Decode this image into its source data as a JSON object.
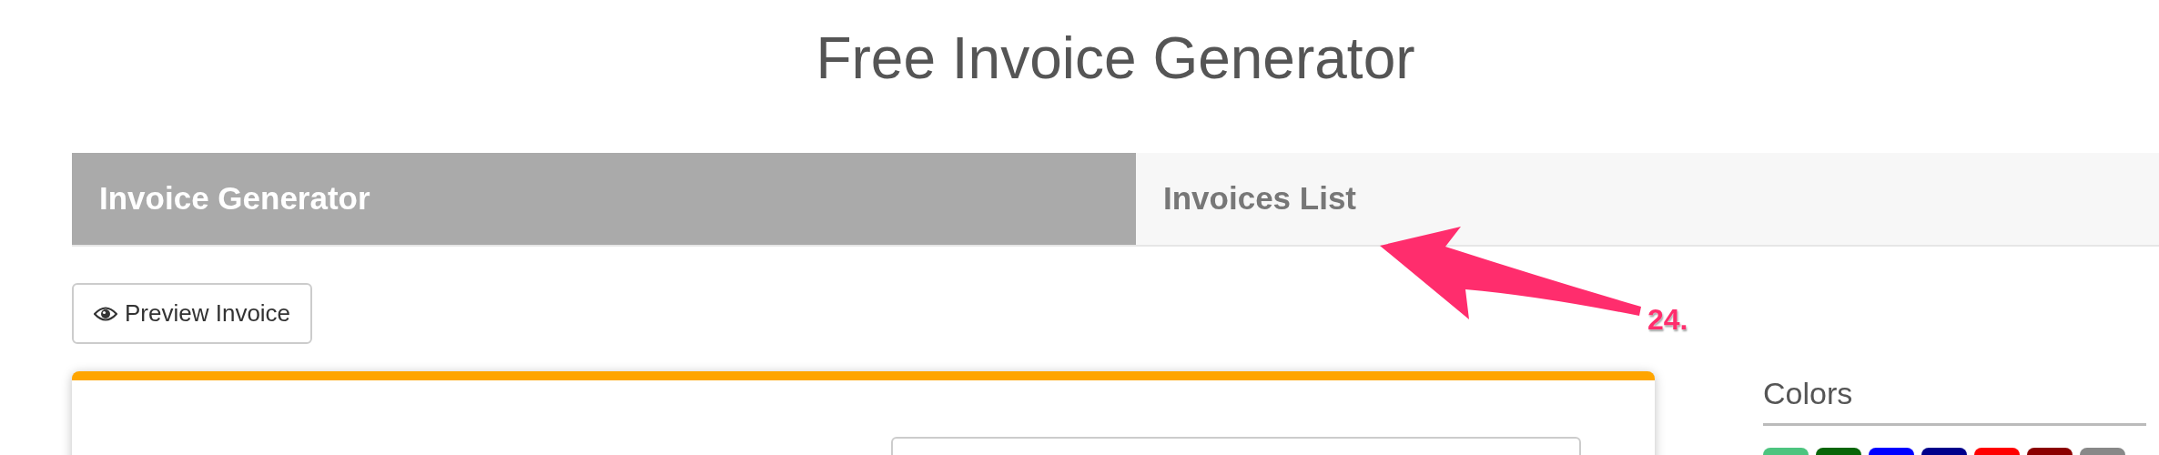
{
  "header": {
    "title": "Free Invoice Generator"
  },
  "tabs": [
    {
      "label": "Invoice Generator",
      "selected": true
    },
    {
      "label": "Invoices List",
      "selected": false
    }
  ],
  "toolbar": {
    "preview_button": "Preview Invoice"
  },
  "sidebar": {
    "heading": "Colors",
    "colors": [
      {
        "color": "#4dc47f"
      },
      {
        "color": "#086508"
      },
      {
        "color": "#0000ff"
      },
      {
        "color": "#00008b"
      },
      {
        "color": "#ff0000"
      },
      {
        "color": "#8b0000"
      },
      {
        "color": "#888888"
      }
    ]
  },
  "annotation": {
    "label": "24."
  }
}
